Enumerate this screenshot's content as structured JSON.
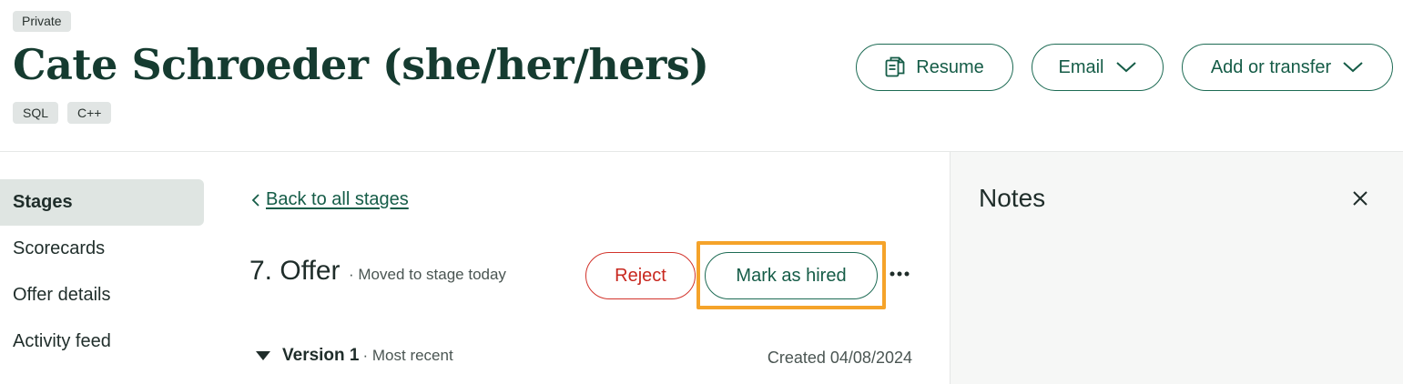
{
  "candidate": {
    "visibility_badge": "Private",
    "name": "Cate Schroeder  (she/her/hers)",
    "tags": [
      "SQL",
      "C++"
    ]
  },
  "header_actions": {
    "resume_label": "Resume",
    "email_label": "Email",
    "add_transfer_label": "Add or transfer"
  },
  "sidebar": {
    "items": [
      {
        "label": "Stages",
        "active": true
      },
      {
        "label": "Scorecards",
        "active": false
      },
      {
        "label": "Offer details",
        "active": false
      },
      {
        "label": "Activity feed",
        "active": false
      }
    ]
  },
  "stage": {
    "back_link": "Back to all stages",
    "title": "7. Offer",
    "meta": "·  Moved to stage today",
    "reject_label": "Reject",
    "mark_hired_label": "Mark as hired",
    "more_icon": "ellipsis-icon"
  },
  "offer": {
    "version_title": "Version 1",
    "version_sub": "· Most recent",
    "created": "Created 04/08/2024"
  },
  "notes": {
    "title": "Notes"
  },
  "colors": {
    "brand_green": "#155c47",
    "reject_red": "#c8281f",
    "highlight": "#f5a32a",
    "name_color": "#153b30"
  }
}
